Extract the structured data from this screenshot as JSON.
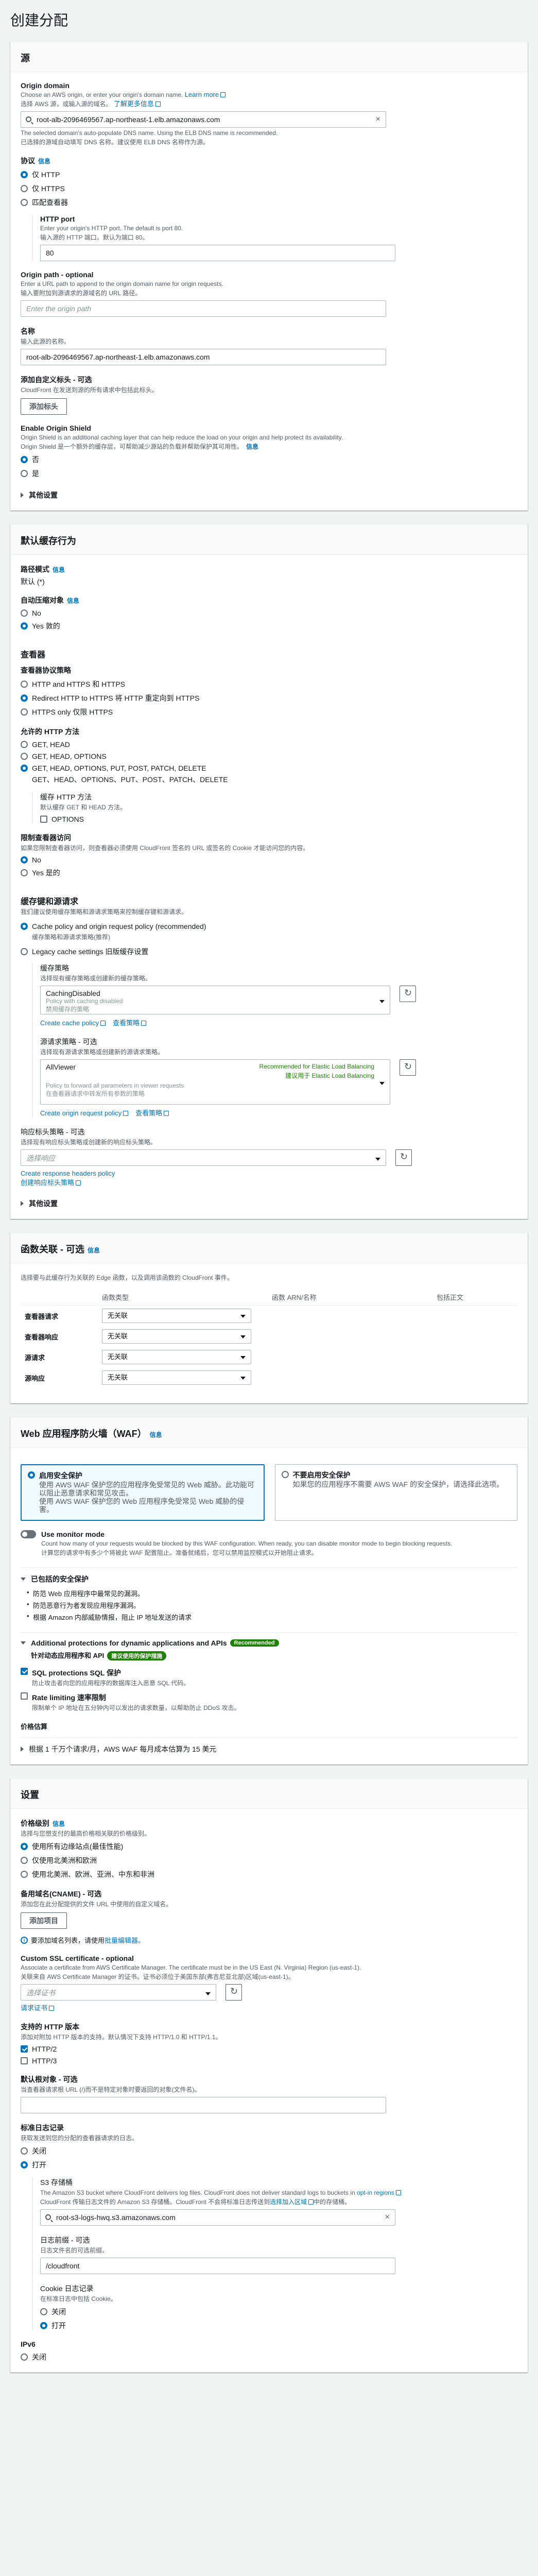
{
  "page_title": "创建分配",
  "origin": {
    "panel_title": "源",
    "domain_label": "Origin domain",
    "domain_desc_en": "Choose an AWS origin, or enter your origin's domain name.",
    "domain_desc_link": "Learn more",
    "domain_desc_zh": "选择 AWS 源，或输入源的域名。",
    "domain_desc_zh_link": "了解更多信息",
    "domain_value": "root-alb-2096469567.ap-northeast-1.elb.amazonaws.com",
    "domain_hint_en": "The selected domain's auto-populate DNS name. Using the ELB DNS name is recommended.",
    "domain_hint_zh": "已选择的源域自动填写 DNS 名称。建议使用 ELB DNS 名称作为源。",
    "protocol_label": "协议",
    "protocol_info": "信息",
    "protocol_options": [
      "仅 HTTP",
      "仅 HTTPS",
      "匹配查看器"
    ],
    "http_port_label": "HTTP port",
    "http_port_desc": "Enter your origin's HTTP port. The default is port 80.",
    "http_port_desc_zh": "输入源的 HTTP 端口。默认为端口 80。",
    "http_port_value": "80",
    "path_label": "Origin path - optional",
    "path_desc": "Enter a URL path to append to the origin domain name for origin requests.",
    "path_desc_zh": "输入要附加到源请求的源域名的 URL 路径。",
    "path_placeholder": "Enter the origin path",
    "name_label": "名称",
    "name_desc": "输入此源的名称。",
    "name_value": "root-alb-2096469567.ap-northeast-1.elb.amazonaws.com",
    "headers_label": "添加自定义标头 - 可选",
    "headers_desc": "CloudFront 在发送到源的所有请求中包括此标头。",
    "headers_button": "添加标头",
    "shield_label": "Enable Origin Shield",
    "shield_desc": "Origin Shield is an additional caching layer that can help reduce the load on your origin and help protect its availability.",
    "shield_desc_zh": "Origin Shield 是一个额外的缓存层，可帮助减少源站的负载并帮助保护其可用性。",
    "shield_info": "信息",
    "shield_options": [
      "否",
      "是"
    ],
    "additional": "其他设置"
  },
  "behavior": {
    "panel_title": "默认缓存行为",
    "path_label": "路径模式",
    "path_info": "信息",
    "path_value": "默认 (*)",
    "compress_label": "自动压缩对象",
    "compress_info": "信息",
    "compress_options": [
      "No",
      "Yes 敦的"
    ],
    "viewer_title": "查看器",
    "vpp_label": "查看器协议策略",
    "vpp_options": [
      "HTTP and HTTPS 和 HTTPS",
      "Redirect HTTP to HTTPS 将 HTTP 重定向到 HTTPS",
      "HTTPS only 仅限 HTTPS"
    ],
    "methods_label": "允许的 HTTP 方法",
    "methods_options": [
      "GET, HEAD",
      "GET, HEAD, OPTIONS",
      "GET, HEAD, OPTIONS, PUT, POST, PATCH, DELETE"
    ],
    "methods_sub": "GET、HEAD、OPTIONS、PUT、POST、PATCH、DELETE",
    "cache_methods_label": "缓存 HTTP 方法",
    "cache_methods_desc": "默认缓存 GET 和 HEAD 方法。",
    "cache_options_label": "OPTIONS",
    "restrict_label": "限制查看器访问",
    "restrict_desc": "如果您限制查看器访问，则查看器必须使用 CloudFront 签名的 URL 或签名的 Cookie 才能访问您的内容。",
    "restrict_options": [
      "No",
      "Yes 是的"
    ],
    "key_title": "缓存键和源请求",
    "key_desc": "我们建议使用缓存策略和源请求策略来控制缓存键和源请求。",
    "key_options": [
      "Cache policy and origin request policy (recommended)",
      "Legacy cache settings 旧版缓存设置"
    ],
    "key_option_zh": "缓存策略和源请求策略(推荐)",
    "cache_policy_label": "缓存策略",
    "cache_policy_desc": "选择现有缓存策略或创建新的缓存策略。",
    "cache_policy_value": "CachingDisabled",
    "cache_policy_sub": "Policy with caching disabled",
    "cache_policy_sub_zh": "禁用缓存的策略",
    "create_cache": "Create cache policy",
    "view_policy": "查看策略",
    "orp_label": "源请求策略 - 可选",
    "orp_desc": "选择现有源请求策略或创建新的源请求策略。",
    "orp_value": "AllViewer",
    "orp_rec": "Recommended for Elastic Load Balancing",
    "orp_rec_zh": "建议用于 Elastic Load Balancing",
    "orp_sub": "Policy to forward all parameters in viewer requests",
    "orp_sub_zh": "在查看器请求中转发所有参数的策略",
    "create_orp": "Create origin request policy",
    "view_orp": "查看策略",
    "rhp_label": "响应标头策略 - 可选",
    "rhp_desc": "选择现有响应标头策略或创建新的响应标头策略。",
    "rhp_placeholder": "选择响应",
    "create_rhp": "Create response headers policy",
    "create_rhp_zh": "创建响应标头策略",
    "additional": "其他设置"
  },
  "functions": {
    "panel_title": "函数关联 - 可选",
    "info": "信息",
    "desc": "选择要与此缓存行为关联的 Edge 函数，以及调用该函数的 CloudFront 事件。",
    "headers": [
      "",
      "函数类型",
      "函数 ARN/名称",
      "包括正文"
    ],
    "rows": [
      {
        "event": "查看器请求",
        "type": "无关联"
      },
      {
        "event": "查看器响应",
        "type": "无关联"
      },
      {
        "event": "源请求",
        "type": "无关联"
      },
      {
        "event": "源响应",
        "type": "无关联"
      }
    ]
  },
  "waf": {
    "panel_title": "Web 应用程序防火墙（WAF）",
    "info": "信息",
    "card_on_title": "启用安全保护",
    "card_on_desc": "使用 AWS WAF 保护您的应用程序免受常见的 Web 威胁。此功能可以阻止恶意请求和常见攻击。",
    "card_on_desc_zh": "使用 AWS WAF 保护您的 Web 应用程序免受常见 Web 威胁的侵害。",
    "card_off_title": "不要启用安全保护",
    "card_off_desc": "如果您的应用程序不需要 AWS WAF 的安全保护，请选择此选项。",
    "monitor_label": "Use monitor mode",
    "monitor_desc": "Count how many of your requests would be blocked by this WAF configuration. When ready, you can disable monitor mode to begin blocking requests.",
    "monitor_desc_zh": "计算您的请求中有多少个将被此 WAF 配置阻止。准备就绪后，您可以禁用监控模式以开始阻止请求。",
    "included_title": "已包括的安全保护",
    "included": [
      "防范 Web 应用程序中最常见的漏洞。",
      "防范恶意行为者发现应用程序漏洞。",
      "根据 Amazon 内部威胁情报，阻止 IP 地址发送的请求"
    ],
    "additional_title": "Additional protections for dynamic applications and APIs",
    "recommended": "Recommended",
    "additional_zh": "针对动态应用程序和 API",
    "recommended_zh": "建议使用的保护措施",
    "sql_label": "SQL protections SQL 保护",
    "sql_desc": "防止攻击者向您的应用程序的数据库注入恶意 SQL 代码。",
    "rate_label": "Rate limiting 速率限制",
    "rate_desc": "限制单个 IP 地址在五分钟内可以发出的请求数量，以帮助防止 DDoS 攻击。",
    "price_label": "价格估算",
    "price_desc": "根据 1 千万个请求/月，AWS WAF 每月成本估算为 15 美元"
  },
  "settings": {
    "panel_title": "设置",
    "price_label": "价格级别",
    "price_info": "信息",
    "price_desc": "选择与您想支付的最高价格相关联的价格级别。",
    "price_options": [
      "使用所有边缘站点(最佳性能)",
      "仅使用北美洲和欧洲",
      "使用北美洲、欧洲、亚洲、中东和非洲"
    ],
    "cname_label": "备用域名(CNAME) - 可选",
    "cname_desc": "添加您在此分配提供的文件 URL 中使用的自定义域名。",
    "cname_button": "添加项目",
    "cname_warn": "要添加域名列表，请使用",
    "cname_warn_link": "批量编辑器。",
    "ssl_label": "Custom SSL certificate - optional",
    "ssl_desc": "Associate a certificate from AWS Certificate Manager. The certificate must be in the US East (N. Virginia) Region (us-east-1).",
    "ssl_desc_zh": "关联来自 AWS Certificate Manager 的证书。证书必须位于美国东部(弗吉尼亚北部)区域(us-east-1)。",
    "ssl_placeholder": "选择证书",
    "ssl_request": "请求证书",
    "http_label": "支持的 HTTP 版本",
    "http_desc": "添加对附加 HTTP 版本的支持。默认情况下支持 HTTP/1.0 和 HTTP/1.1。",
    "http_options": [
      "HTTP/2",
      "HTTP/3"
    ],
    "root_label": "默认根对象 - 可选",
    "root_desc": "当查看器请求根 URL (/)而不是特定对象时要返回的对象(文件名)。",
    "log_label": "标准日志记录",
    "log_desc": "获取发送到您的分配的查看器请求的日志。",
    "log_options": [
      "关闭",
      "打开"
    ],
    "s3_label": "S3 存储桶",
    "s3_desc": "The Amazon S3 bucket where CloudFront delivers log files. CloudFront does not deliver standard logs to buckets in",
    "s3_desc_link": "opt-in regions",
    "s3_desc_zh": "CloudFront 传输日志文件的 Amazon S3 存储桶。CloudFront 不会将标准日志传送到",
    "s3_desc_zh_link": "选择加入区域",
    "s3_desc_zh2": "中的存储桶。",
    "s3_value": "root-s3-logs-hwq.s3.amazonaws.com",
    "prefix_label": "日志前缀 - 可选",
    "prefix_desc": "日志文件名的可选前缀。",
    "prefix_value": "/cloudfront",
    "cookie_label": "Cookie 日志记录",
    "cookie_desc": "在标准日志中包括 Cookie。",
    "cookie_options": [
      "关闭",
      "打开"
    ],
    "ipv6_label": "IPv6",
    "ipv6_options": [
      "关闭"
    ]
  }
}
